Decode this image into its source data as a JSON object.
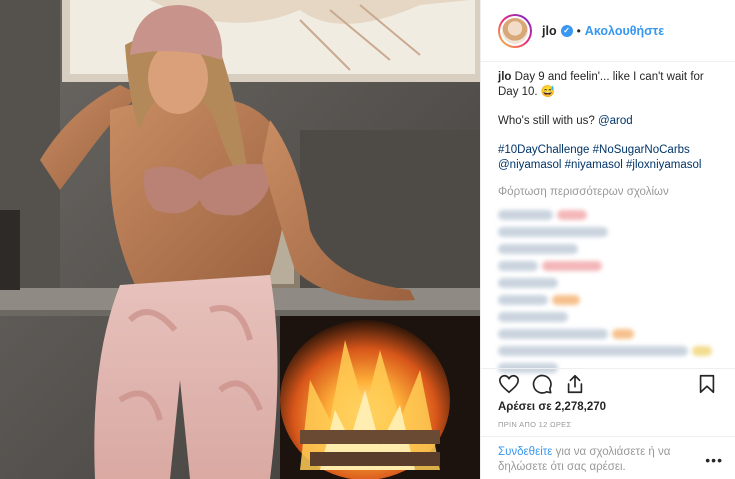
{
  "header": {
    "username": "jlo",
    "separator": "•",
    "follow_label": "Ακολουθήστε",
    "verified_glyph": "✓"
  },
  "caption": {
    "username": "jlo",
    "line1": " Day 9 and feelin'... like I can't wait for Day 10. 😅",
    "line2_text": "Who's still with us? ",
    "mention": "@arod",
    "hashtag1": "#10DayChallenge",
    "hashtag2": "#NoSugarNoCarbs",
    "mention2": "@niyamasol",
    "hashtag3": "#niyamasol",
    "hashtag4": "#jloxniyamasol"
  },
  "load_more_label": "Φόρτωση περισσότερων σχολίων",
  "blurred_comment_colors": {
    "text": "#c9d3de",
    "pink": "#f4b6b8",
    "orange": "#f6c08c",
    "yellow": "#f2dc8e"
  },
  "actions": {
    "like_icon": "heart-icon",
    "comment_icon": "comment-icon",
    "share_icon": "share-icon",
    "save_icon": "bookmark-icon"
  },
  "likes_text": "Αρέσει σε 2,278,270",
  "time_text": "ΠΡΙΝ ΑΠΟ 12 ΩΡΕΣ",
  "login": {
    "link": "Συνδεθείτε",
    "rest": " για να σχολιάσετε ή να δηλώσετε ότι σας αρέσει.",
    "more": "•••"
  },
  "colors": {
    "accent": "#3897f0",
    "link": "#003569",
    "muted": "#999999"
  }
}
